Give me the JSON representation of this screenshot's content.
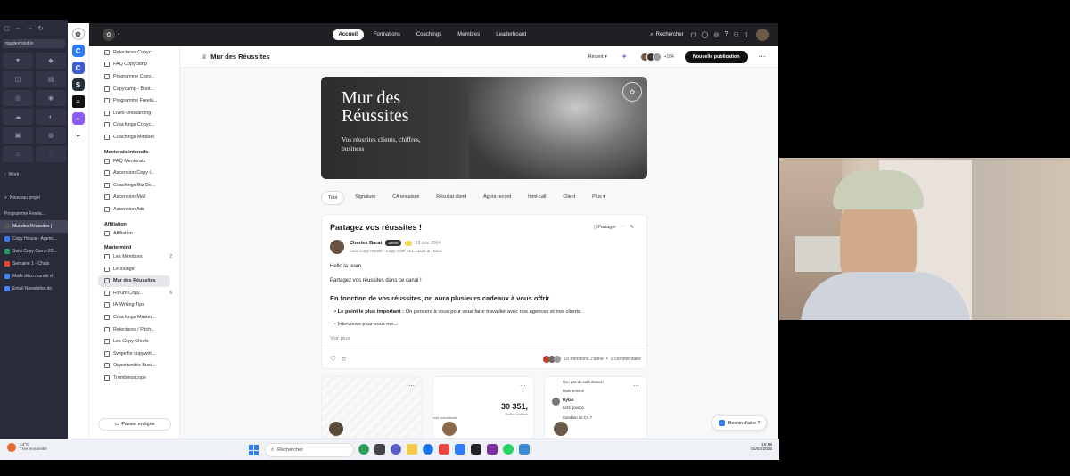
{
  "browser": {
    "workspace": "mastermind.io",
    "section_label": "Work",
    "new_project": "Nouveau projet",
    "tabs": [
      "Programme Freela...",
      "Mur des Réussites |",
      "Copy House - Agenc...",
      "Suivi Copy Camp 20...",
      "Semaine 1 - Chats",
      "Mails déco murale d",
      "Email Newsletter.do"
    ]
  },
  "topnav": {
    "tabs": [
      "Accueil",
      "Formations",
      "Coachings",
      "Membres",
      "Leaderboard"
    ],
    "active_tab": "Accueil",
    "search_label": "Rechercher"
  },
  "sidebar": {
    "top_items": [
      "Relectures Copyc...",
      "FAQ Copycamp",
      "Programme Copy...",
      "Copycamp - Boot...",
      "Programme Freela...",
      "Lives Onboarding",
      "Coachings Copyc...",
      "Coachings Mindset"
    ],
    "mentorats_title": "Mentorats intensifs",
    "mentorats_items": [
      "FAQ Mentorats",
      "Ascension Copy l...",
      "Coachings Biz De...",
      "Ascension Mail",
      "Ascension Ads"
    ],
    "affiliation_title": "Affiliation",
    "affiliation_items": [
      "Affiliation"
    ],
    "mastermind_title": "Mastermind",
    "mastermind_items": [
      {
        "label": "Les Membres",
        "badge": "2"
      },
      {
        "label": "Le lounge",
        "badge": ""
      },
      {
        "label": "Mur des Réussites",
        "badge": ""
      },
      {
        "label": "Forum Copy...",
        "badge": "6"
      },
      {
        "label": "IA-Writing Tips",
        "badge": ""
      },
      {
        "label": "Coachings Master...",
        "badge": ""
      },
      {
        "label": "Relectures / Pitch...",
        "badge": ""
      },
      {
        "label": "Les Copy Chiefs",
        "badge": ""
      },
      {
        "label": "Swipefile copywrit...",
        "badge": ""
      },
      {
        "label": "Opportunités Busi...",
        "badge": ""
      },
      {
        "label": "Trombinoscope",
        "badge": ""
      }
    ],
    "active_item": "Mur des Réussites",
    "go_online": "Passer en ligne"
  },
  "header": {
    "title": "Mur des Réussites",
    "sort": "Récent",
    "member_count": "+164",
    "new_post": "Nouvelle publication"
  },
  "banner": {
    "title_line1": "Mur des",
    "title_line2": "Réussites",
    "subtitle_line1": "Vos réussites clients, chiffres,",
    "subtitle_line2": "business"
  },
  "filters": [
    "Tout",
    "Signature",
    "CA encaissé",
    "Résultat client",
    "Agora record",
    "html-call",
    "Client",
    "Plus"
  ],
  "post": {
    "title": "Partagez vos réussites !",
    "share_label": "Partager",
    "author": "Charles Barat",
    "author_badge": "Admin",
    "date": "23 nov. 2024",
    "author_role": "CEO Copy House - Copy chief SKL CLUB & TEEO",
    "greeting": "Hello la team.",
    "intro": "Partagez vos réussites dans ce canal !",
    "heading": "En fonction de vos réussites, on aura plusieurs cadeaux à vous offrir",
    "bullet1_bold": "Le point le plus important :",
    "bullet1_text": " On pensera à vous pour vous faire travailler avec nos agences et nos clients.",
    "bullet2": "Interviews pour vous me...",
    "see_more": "Voir plus",
    "likes": "15 mentions J'aime",
    "comments": "0 commentaire"
  },
  "cards": {
    "stat_value": "30 351,",
    "stat_label": "Chiffre d'affaire",
    "stat_period": "ode précédente",
    "chat_line1": "Non pas de calls demain",
    "chat_line2": "Mais terminé",
    "chat_name": "Dylan",
    "chat_msg": "Let's gooooo",
    "chat_q": "Combien de CA ?",
    "help": "Besoin d'aide ?"
  },
  "taskbar": {
    "weather_temp": "14°C",
    "weather_desc": "Très ensoleillé",
    "search": "Rechercher",
    "time": "15:59",
    "date": "01/03/2026"
  },
  "colors": {
    "accent_blue": "#2f7bf6",
    "nav_dark": "#1f2023",
    "browser_sidebar": "#2a2b3a"
  }
}
